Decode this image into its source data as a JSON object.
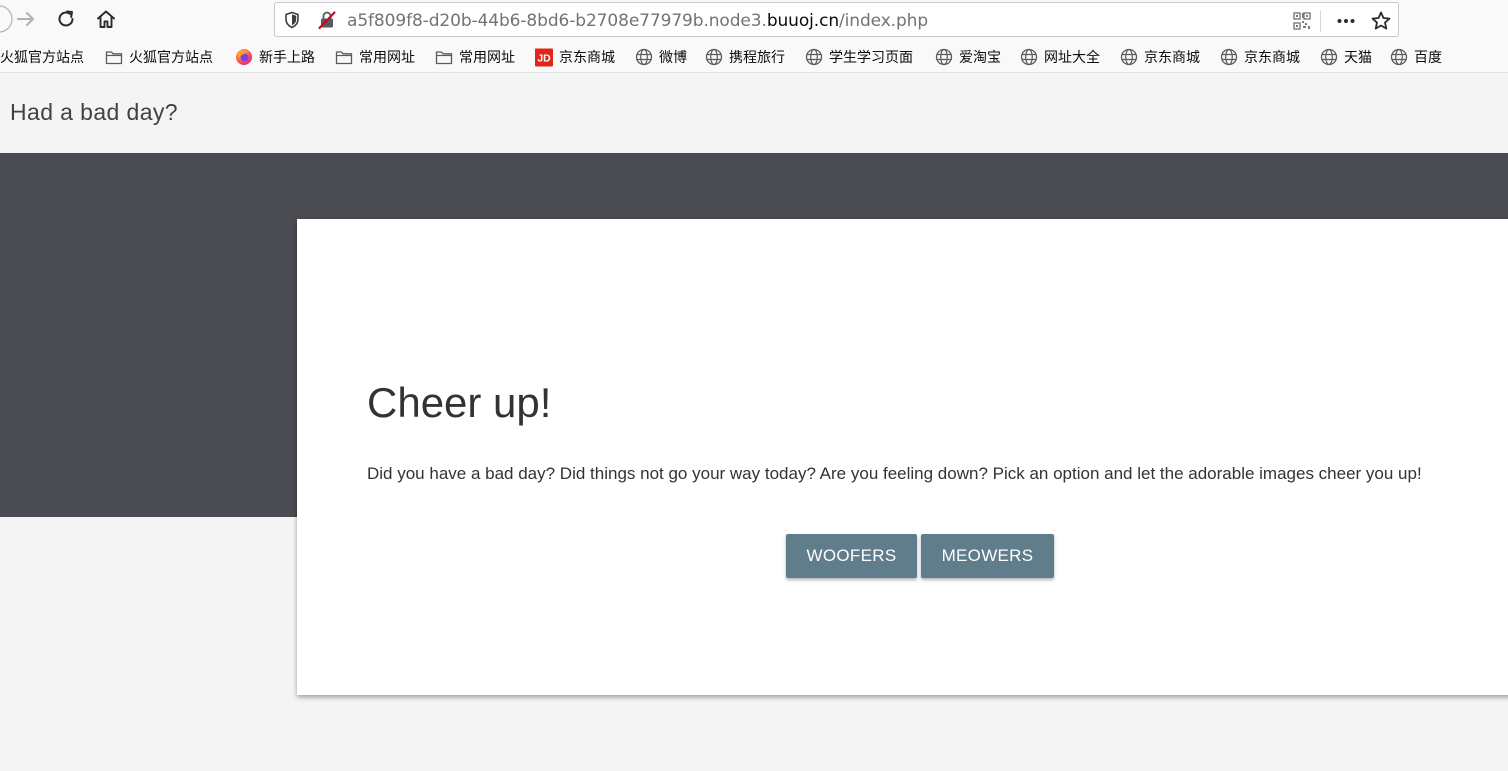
{
  "browser": {
    "url_prefix": "a5f809f8-d20b-44b6-8bd6-b2708e77979b.node3.",
    "url_host": "buuoj.cn",
    "url_path": "/index.php"
  },
  "bookmarks": [
    {
      "label": "火狐官方站点",
      "icon": "none"
    },
    {
      "label": "火狐官方站点",
      "icon": "folder-icon"
    },
    {
      "label": "新手上路",
      "icon": "firefox-icon"
    },
    {
      "label": "常用网址",
      "icon": "folder-icon"
    },
    {
      "label": "常用网址",
      "icon": "folder-icon"
    },
    {
      "label": "京东商城",
      "icon": "jd-icon",
      "icon_text": "JD"
    },
    {
      "label": "微博",
      "icon": "globe-icon"
    },
    {
      "label": "携程旅行",
      "icon": "globe-icon"
    },
    {
      "label": "学生学习页面",
      "icon": "globe-icon"
    },
    {
      "label": "爱淘宝",
      "icon": "globe-icon"
    },
    {
      "label": "网址大全",
      "icon": "globe-icon"
    },
    {
      "label": "京东商城",
      "icon": "globe-icon"
    },
    {
      "label": "京东商城",
      "icon": "globe-icon"
    },
    {
      "label": "天猫",
      "icon": "globe-icon"
    },
    {
      "label": "百度",
      "icon": "globe-icon"
    }
  ],
  "site": {
    "title": "Had a bad day?"
  },
  "card": {
    "heading": "Cheer up!",
    "text": "Did you have a bad day? Did things not go your way today? Are you feeling down? Pick an option and let the adorable images cheer you up!",
    "buttons": {
      "woofers": "WOOFERS",
      "meowers": "MEOWERS"
    }
  },
  "colors": {
    "hero_band": "#4b4c51",
    "button": "#607d8b",
    "page_bg": "#f4f4f4",
    "jd_red": "#e1251b"
  }
}
